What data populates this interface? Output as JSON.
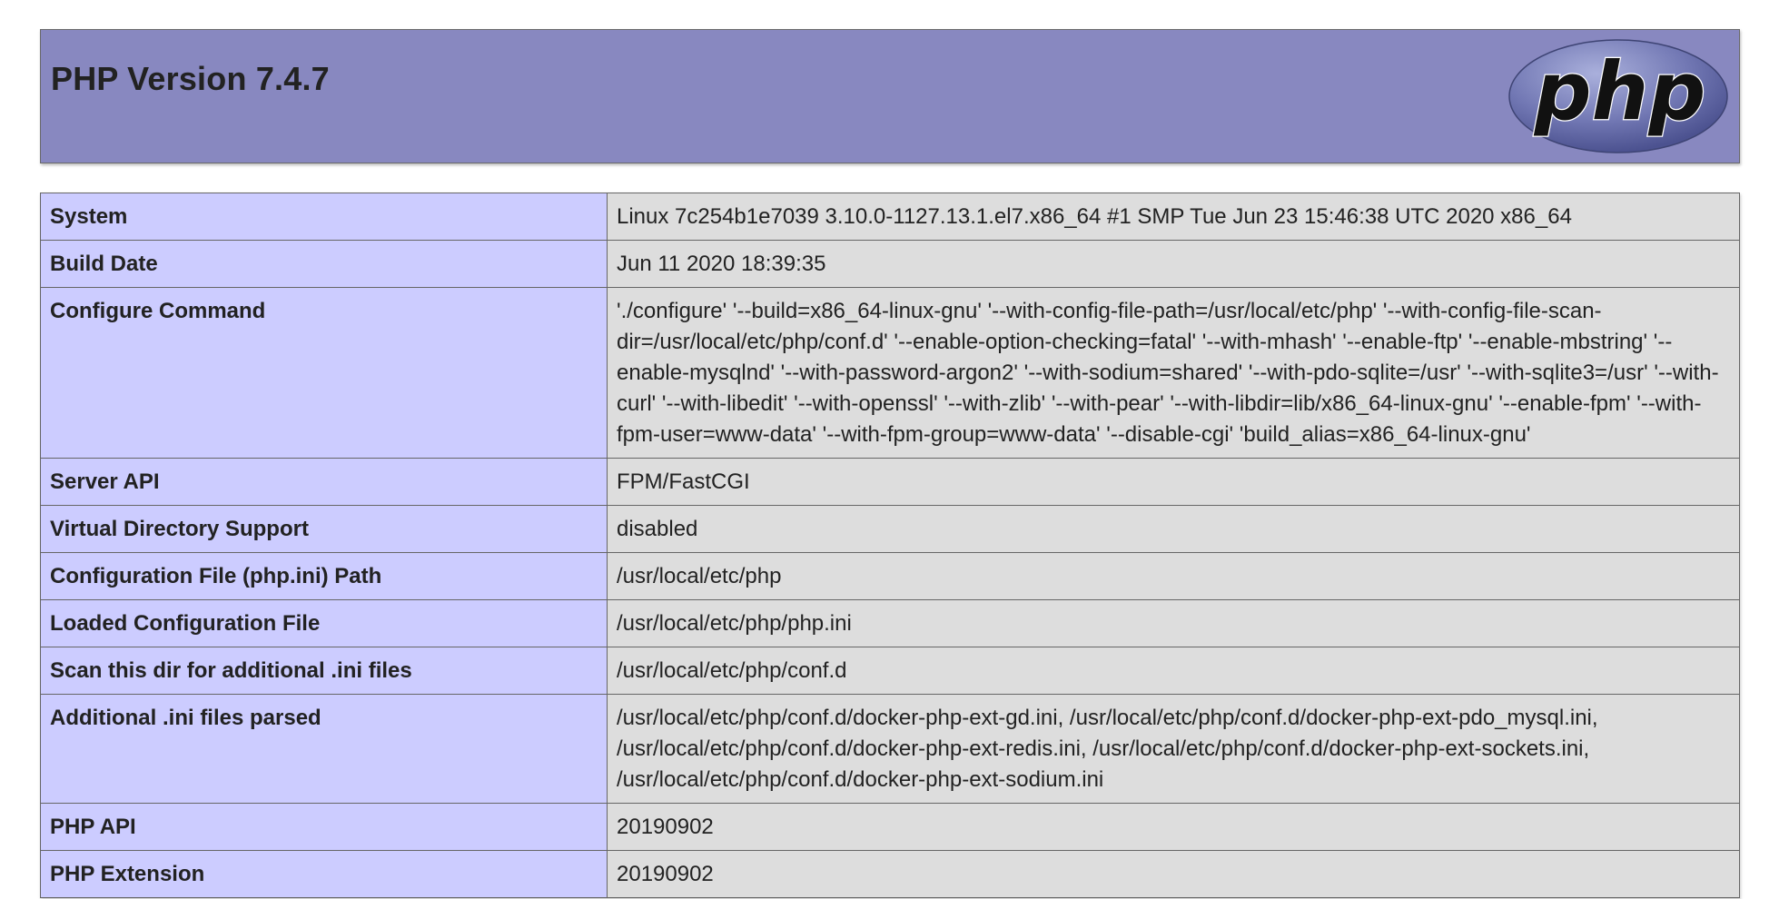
{
  "header": {
    "title": "PHP Version 7.4.7",
    "logo_text": "php"
  },
  "colors": {
    "header_bg": "#8888c0",
    "key_cell_bg": "#ccccff",
    "value_cell_bg": "#dddddd",
    "logo_oval": "#6c72b0"
  },
  "info_rows": [
    {
      "key": "System",
      "value": "Linux 7c254b1e7039 3.10.0-1127.13.1.el7.x86_64 #1 SMP Tue Jun 23 15:46:38 UTC 2020 x86_64"
    },
    {
      "key": "Build Date",
      "value": "Jun 11 2020 18:39:35"
    },
    {
      "key": "Configure Command",
      "value": "'./configure' '--build=x86_64-linux-gnu' '--with-config-file-path=/usr/local/etc/php' '--with-config-file-scan-dir=/usr/local/etc/php/conf.d' '--enable-option-checking=fatal' '--with-mhash' '--enable-ftp' '--enable-mbstring' '--enable-mysqlnd' '--with-password-argon2' '--with-sodium=shared' '--with-pdo-sqlite=/usr' '--with-sqlite3=/usr' '--with-curl' '--with-libedit' '--with-openssl' '--with-zlib' '--with-pear' '--with-libdir=lib/x86_64-linux-gnu' '--enable-fpm' '--with-fpm-user=www-data' '--with-fpm-group=www-data' '--disable-cgi' 'build_alias=x86_64-linux-gnu'"
    },
    {
      "key": "Server API",
      "value": "FPM/FastCGI"
    },
    {
      "key": "Virtual Directory Support",
      "value": "disabled"
    },
    {
      "key": "Configuration File (php.ini) Path",
      "value": "/usr/local/etc/php"
    },
    {
      "key": "Loaded Configuration File",
      "value": "/usr/local/etc/php/php.ini"
    },
    {
      "key": "Scan this dir for additional .ini files",
      "value": "/usr/local/etc/php/conf.d"
    },
    {
      "key": "Additional .ini files parsed",
      "value": "/usr/local/etc/php/conf.d/docker-php-ext-gd.ini, /usr/local/etc/php/conf.d/docker-php-ext-pdo_mysql.ini, /usr/local/etc/php/conf.d/docker-php-ext-redis.ini, /usr/local/etc/php/conf.d/docker-php-ext-sockets.ini, /usr/local/etc/php/conf.d/docker-php-ext-sodium.ini"
    },
    {
      "key": "PHP API",
      "value": "20190902"
    },
    {
      "key": "PHP Extension",
      "value": "20190902"
    }
  ]
}
